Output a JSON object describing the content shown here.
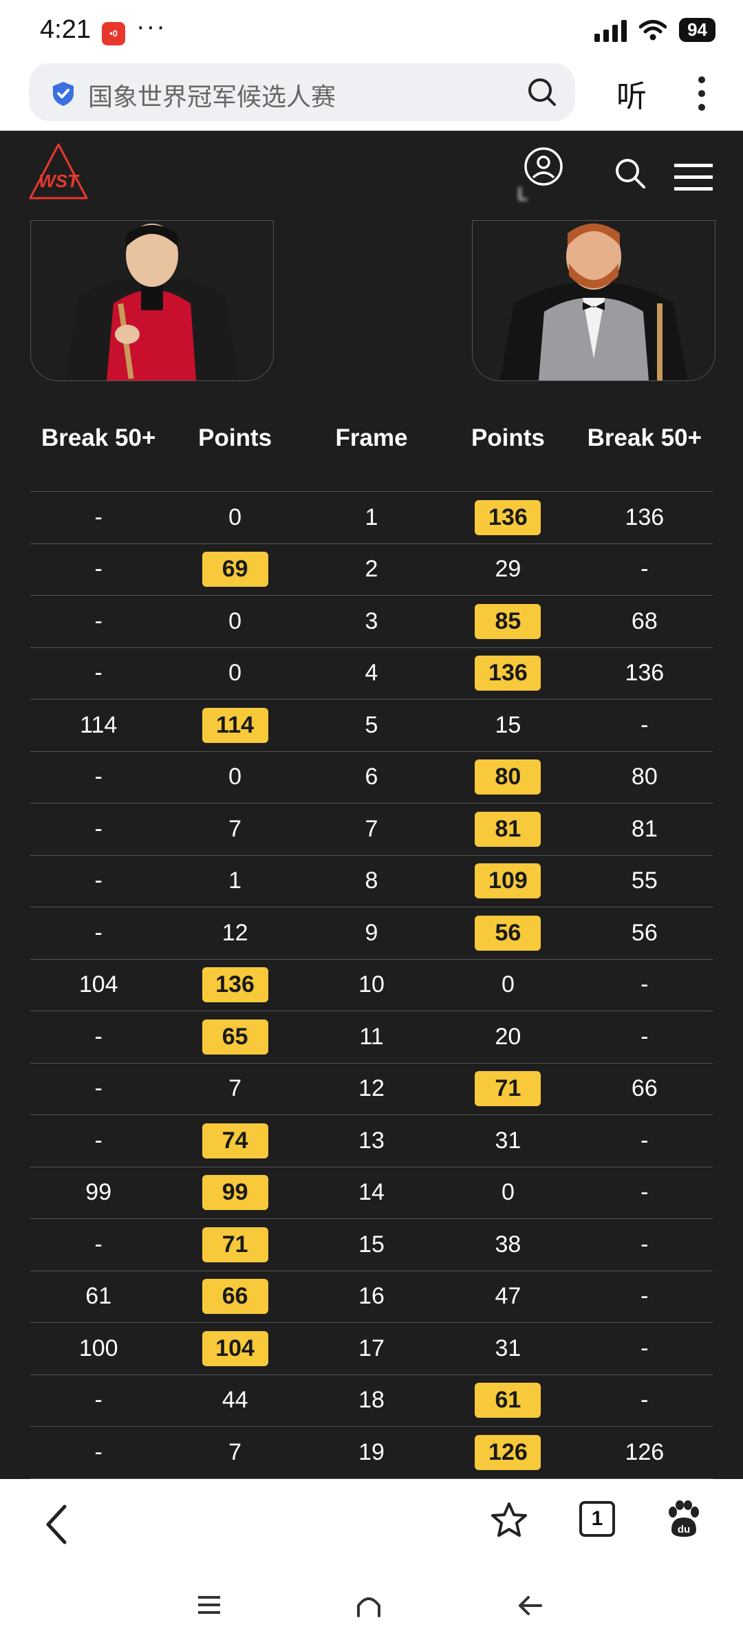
{
  "status": {
    "time": "4:21",
    "app_badge": "•0",
    "dots": "···",
    "battery": "94"
  },
  "browser": {
    "search_text": "国象世界冠军候选人赛",
    "listen_label": "听"
  },
  "site": {
    "logo_text": "WST",
    "login_label": "L"
  },
  "table": {
    "headers": [
      "Break 50+",
      "Points",
      "Frame",
      "Points",
      "Break 50+"
    ],
    "rows": [
      {
        "lb": "-",
        "lp": "0",
        "f": "1",
        "rp": "136",
        "rb": "136",
        "win": "right"
      },
      {
        "lb": "-",
        "lp": "69",
        "f": "2",
        "rp": "29",
        "rb": "-",
        "win": "left"
      },
      {
        "lb": "-",
        "lp": "0",
        "f": "3",
        "rp": "85",
        "rb": "68",
        "win": "right"
      },
      {
        "lb": "-",
        "lp": "0",
        "f": "4",
        "rp": "136",
        "rb": "136",
        "win": "right"
      },
      {
        "lb": "114",
        "lp": "114",
        "f": "5",
        "rp": "15",
        "rb": "-",
        "win": "left"
      },
      {
        "lb": "-",
        "lp": "0",
        "f": "6",
        "rp": "80",
        "rb": "80",
        "win": "right"
      },
      {
        "lb": "-",
        "lp": "7",
        "f": "7",
        "rp": "81",
        "rb": "81",
        "win": "right"
      },
      {
        "lb": "-",
        "lp": "1",
        "f": "8",
        "rp": "109",
        "rb": "55",
        "win": "right"
      },
      {
        "lb": "-",
        "lp": "12",
        "f": "9",
        "rp": "56",
        "rb": "56",
        "win": "right"
      },
      {
        "lb": "104",
        "lp": "136",
        "f": "10",
        "rp": "0",
        "rb": "-",
        "win": "left"
      },
      {
        "lb": "-",
        "lp": "65",
        "f": "11",
        "rp": "20",
        "rb": "-",
        "win": "left"
      },
      {
        "lb": "-",
        "lp": "7",
        "f": "12",
        "rp": "71",
        "rb": "66",
        "win": "right"
      },
      {
        "lb": "-",
        "lp": "74",
        "f": "13",
        "rp": "31",
        "rb": "-",
        "win": "left"
      },
      {
        "lb": "99",
        "lp": "99",
        "f": "14",
        "rp": "0",
        "rb": "-",
        "win": "left"
      },
      {
        "lb": "-",
        "lp": "71",
        "f": "15",
        "rp": "38",
        "rb": "-",
        "win": "left"
      },
      {
        "lb": "61",
        "lp": "66",
        "f": "16",
        "rp": "47",
        "rb": "-",
        "win": "left"
      },
      {
        "lb": "100",
        "lp": "104",
        "f": "17",
        "rp": "31",
        "rb": "-",
        "win": "left"
      },
      {
        "lb": "-",
        "lp": "44",
        "f": "18",
        "rp": "61",
        "rb": "-",
        "win": "right"
      },
      {
        "lb": "-",
        "lp": "7",
        "f": "19",
        "rp": "126",
        "rb": "126",
        "win": "right"
      }
    ]
  },
  "bottom": {
    "tab_count": "1"
  },
  "colors": {
    "highlight": "#f7c93b",
    "background": "#1e1e1e",
    "brand_red": "#e8382e"
  }
}
